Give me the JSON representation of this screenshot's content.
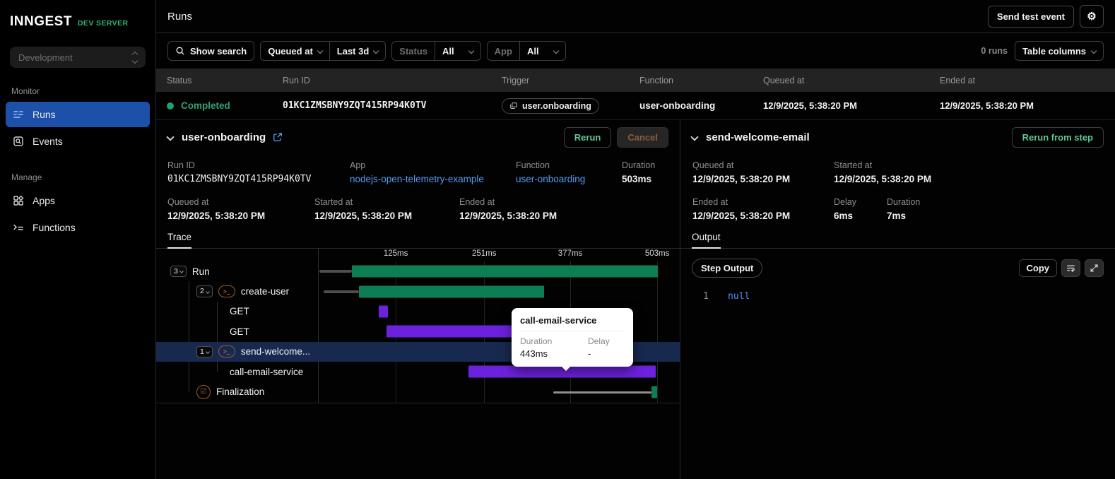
{
  "colors": {
    "accent_blue": "#1d50a9",
    "link_blue": "#539df3",
    "success_green": "#0d7d53",
    "status_green": "#2fa273",
    "bar_purple": "#6c21dd",
    "brand_green": "#2fb573",
    "highlight_row": "#17294e",
    "rerun_green": "#5fc690",
    "cancel_orange": "#8a5c3a"
  },
  "sidebar": {
    "logo": "INNGEST",
    "env_badge": "DEV SERVER",
    "env_select": "Development",
    "monitor_label": "Monitor",
    "runs_label": "Runs",
    "events_label": "Events",
    "manage_label": "Manage",
    "apps_label": "Apps",
    "functions_label": "Functions"
  },
  "header": {
    "title": "Runs",
    "send_test_event": "Send test event"
  },
  "filters": {
    "show_search": "Show search",
    "queued_at": "Queued at",
    "time_range": "Last 3d",
    "status_label": "Status",
    "status_value": "All",
    "app_label": "App",
    "app_value": "All",
    "runs_count": "0 runs",
    "table_columns": "Table columns"
  },
  "table": {
    "headers": [
      "Status",
      "Run ID",
      "Trigger",
      "Function",
      "Queued at",
      "Ended at"
    ],
    "row": {
      "status": "Completed",
      "run_id": "01KC1ZMSBNY9ZQT415RP94K0TV",
      "trigger": "user.onboarding",
      "function": "user-onboarding",
      "queued_at": "12/9/2025, 5:38:20 PM",
      "ended_at": "12/9/2025, 5:38:20 PM"
    }
  },
  "run_panel": {
    "title": "user-onboarding",
    "rerun": "Rerun",
    "cancel": "Cancel",
    "run_id_label": "Run ID",
    "run_id": "01KC1ZMSBNY9ZQT415RP94K0TV",
    "app_label": "App",
    "app": "nodejs-open-telemetry-example",
    "function_label": "Function",
    "function": "user-onboarding",
    "duration_label": "Duration",
    "duration": "503ms",
    "queued_label": "Queued at",
    "queued": "12/9/2025, 5:38:20 PM",
    "started_label": "Started at",
    "started": "12/9/2025, 5:38:20 PM",
    "ended_label": "Ended at",
    "ended": "12/9/2025, 5:38:20 PM",
    "tab": "Trace"
  },
  "trace": {
    "type": "waterfall-trace",
    "max_duration": "503ms",
    "ticks": [
      {
        "label": "125ms",
        "style": "left:22.7%"
      },
      {
        "label": "251ms",
        "style": "left:48.5%"
      },
      {
        "label": "377ms",
        "style": "left:73.6%"
      },
      {
        "label": "503ms",
        "style": "left:99.0%"
      }
    ],
    "rows": [
      {
        "label": "Run",
        "count": "3",
        "line_style": "left:0.4%;width:9.5%",
        "bar_style": "left:9.9%;width:89.2%",
        "bar_color": "green"
      },
      {
        "label": "create-user",
        "count": "2",
        "line_style": "left:1.6%;width:10.4%",
        "bar_style": "left:12%;width:54%",
        "bar_color": "green"
      },
      {
        "label": "GET",
        "bar_style": "left:17.7%;width:2.7%",
        "bar_color": "purple"
      },
      {
        "label": "GET",
        "bar_style": "left:20%;width:39.8%",
        "bar_color": "purple"
      },
      {
        "label": "send-welcome...",
        "count": "1",
        "bar_style": "left:66.4%;width:3.7%",
        "bar_color": "green",
        "highlighted": true
      },
      {
        "label": "call-email-service",
        "bar_style": "left:43.9%;width:54.7%",
        "bar_color": "purple"
      },
      {
        "label": "Finalization",
        "line_style": "left:68.7%;width:28.6%",
        "line_light": true,
        "bar_style": "left:97.3%;width:1.7%",
        "bar_color": "green"
      }
    ]
  },
  "tooltip": {
    "title": "call-email-service",
    "duration_label": "Duration",
    "duration": "443ms",
    "delay_label": "Delay",
    "delay": "-"
  },
  "step_panel": {
    "title": "send-welcome-email",
    "rerun_from_step": "Rerun from step",
    "queued_label": "Queued at",
    "queued": "12/9/2025, 5:38:20 PM",
    "started_label": "Started at",
    "started": "12/9/2025, 5:38:20 PM",
    "ended_label": "Ended at",
    "ended": "12/9/2025, 5:38:20 PM",
    "delay_label": "Delay",
    "delay": "6ms",
    "duration_label": "Duration",
    "duration": "7ms",
    "tab": "Output"
  },
  "output": {
    "badge": "Step Output",
    "copy": "Copy",
    "line_number": "1",
    "code": "null"
  }
}
